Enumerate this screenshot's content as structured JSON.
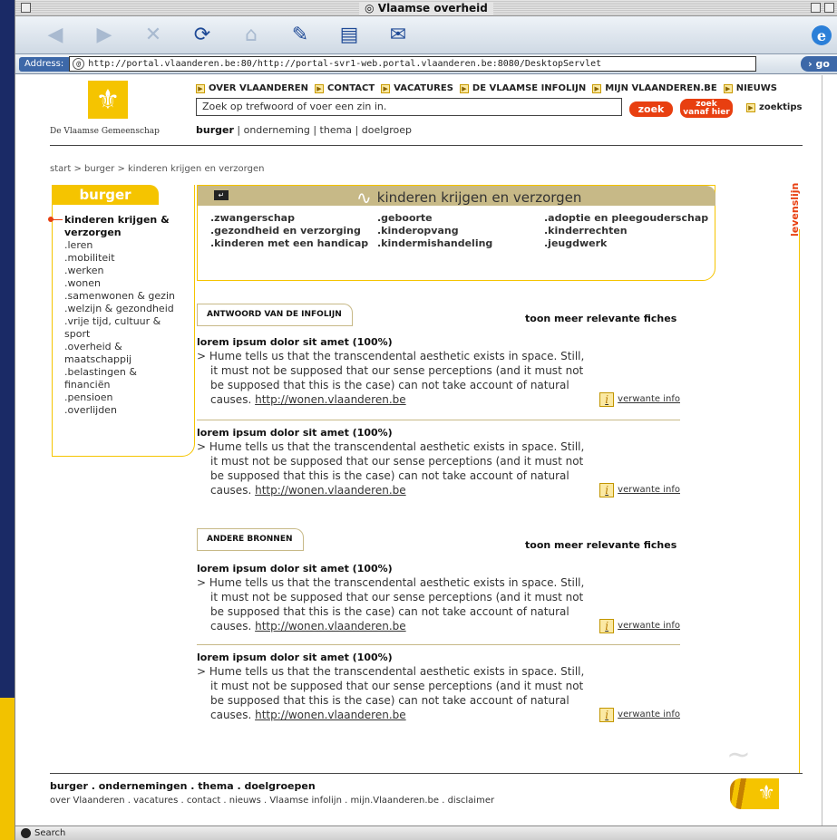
{
  "browser": {
    "title": "Vlaamse overheid",
    "address_label": "Address:",
    "url": "http://portal.vlaanderen.be:80/http://portal-svr1-web.portal.vlaanderen.be:8080/DesktopServlet",
    "go_label": "go",
    "status_label": "Search",
    "ie_label": "e"
  },
  "header": {
    "logo_text": "De Vlaamse Gemeenschap",
    "topnav": [
      "OVER VLAANDEREN",
      "CONTACT",
      "VACATURES",
      "DE VLAAMSE INFOLIJN",
      "MIJN VLAANDEREN.BE",
      "NIEUWS"
    ],
    "search_placeholder": "Zoek op trefwoord of voer een zin in.",
    "zoek_label": "zoek",
    "zoek_hier_line1": "zoek",
    "zoek_hier_line2": "vanaf hier",
    "zoektips_label": "zoektips",
    "subnav_active": "burger",
    "subnav_rest": " | onderneming | thema | doelgroep"
  },
  "breadcrumb": "start > burger > kinderen krijgen en verzorgen",
  "sidebar": {
    "tab_label": "burger",
    "active_item": "kinderen krijgen & verzorgen",
    "items": [
      ".leren",
      ".mobiliteit",
      ".werken",
      ".wonen",
      ".samenwonen & gezin",
      ".welzijn & gezondheid",
      ".vrije tijd, cultuur & sport",
      ".overheid & maatschappij",
      ".belastingen & financiën",
      ".pensioen",
      ".overlijden"
    ]
  },
  "topic": {
    "title": "kinderen krijgen en verzorgen",
    "links": [
      ".zwangerschap",
      ".geboorte",
      ".adoptie en pleegouderschap",
      ".gezondheid en verzorging",
      ".kinderopvang",
      ".kinderrechten",
      ".kinderen met een handicap",
      ".kindermishandeling",
      ".jeugdwerk"
    ]
  },
  "levenslijn": "levenslijn",
  "sections": [
    {
      "heading": "ANTWOORD VAN DE INFOLIJN",
      "more_label": "toon meer relevante fiches",
      "results": [
        {
          "title": "lorem ipsum dolor sit amet (100%)",
          "text": "> Hume tells us that the transcendental aesthetic exists in space. Still, it must not be supposed that our sense perceptions (and it must not be supposed that this is the case) can not take account of natural causes.",
          "link": "http://wonen.vlaanderen.be",
          "related": "verwante info"
        },
        {
          "title": "lorem ipsum dolor sit amet (100%)",
          "text": "> Hume tells us that the transcendental aesthetic exists in space. Still, it must not be supposed that our sense perceptions (and it must not be supposed that this is the case) can not take account of natural causes.",
          "link": "http://wonen.vlaanderen.be",
          "related": "verwante info"
        }
      ]
    },
    {
      "heading": "ANDERE BRONNEN",
      "more_label": "toon meer relevante fiches",
      "results": [
        {
          "title": "lorem ipsum dolor sit amet (100%)",
          "text": "> Hume tells us that the transcendental aesthetic exists in space. Still, it must not be supposed that our sense perceptions (and it must not be supposed that this is the case) can not take account of natural causes.",
          "link": "http://wonen.vlaanderen.be",
          "related": "verwante info"
        },
        {
          "title": "lorem ipsum dolor sit amet (100%)",
          "text": "> Hume tells us that the transcendental aesthetic exists in space. Still, it must not be supposed that our sense perceptions (and it must not be supposed that this is the case) can not take account of natural causes.",
          "link": "http://wonen.vlaanderen.be",
          "related": "verwante info"
        }
      ]
    }
  ],
  "footer": {
    "main": "burger . ondernemingen . thema . doelgroepen",
    "links": "over Vlaanderen . vacatures . contact . nieuws . Vlaamse infolijn . mijn.Vlaanderen.be . disclaimer"
  },
  "colors": {
    "accent": "#f5c400",
    "orange": "#e83f10",
    "tan": "#c7b987",
    "link_blue": "#3d68a8"
  }
}
